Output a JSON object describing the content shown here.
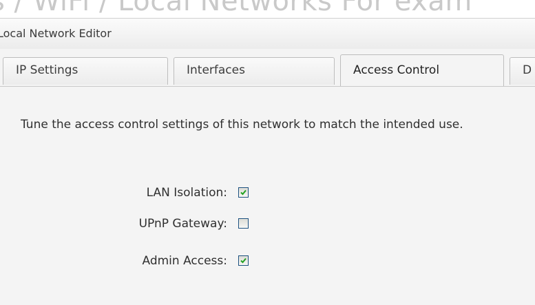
{
  "background": {
    "title": "s / WiFi / Local Networks   For exam"
  },
  "dialog": {
    "title": "Local Network Editor"
  },
  "tabs": [
    {
      "label": "IP Settings",
      "active": false
    },
    {
      "label": "Interfaces",
      "active": false
    },
    {
      "label": "Access Control",
      "active": true
    },
    {
      "label": "D",
      "active": false
    }
  ],
  "access_control": {
    "description": "Tune the access control settings of this network to match the intended use.",
    "fields": [
      {
        "label": "LAN Isolation:",
        "checked": true
      },
      {
        "label": "UPnP Gateway:",
        "checked": false
      },
      {
        "label": "Admin Access:",
        "checked": true
      }
    ]
  },
  "colors": {
    "checkmark": "#21a121",
    "checkbox_border": "#1c5180"
  }
}
